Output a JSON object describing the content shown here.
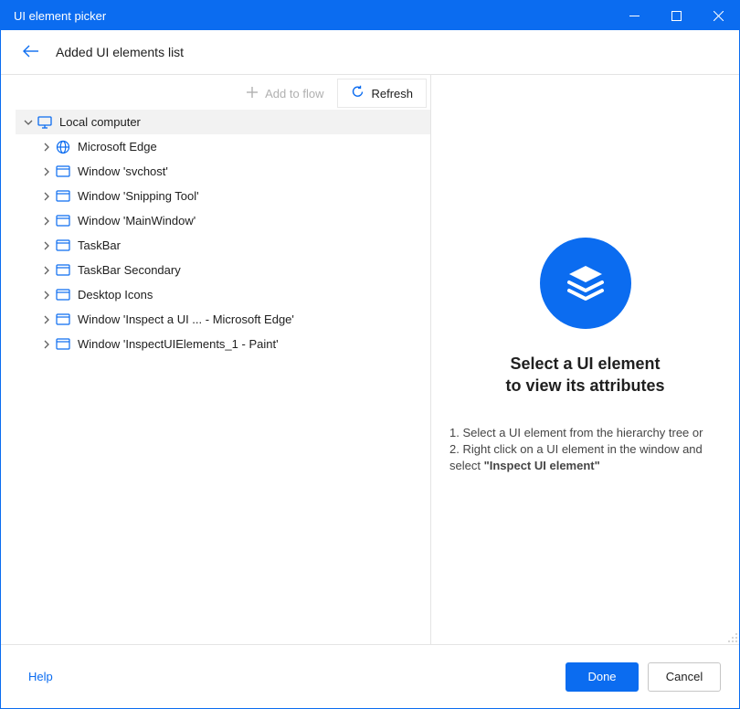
{
  "window": {
    "title": "UI element picker"
  },
  "subheader": {
    "title": "Added UI elements list"
  },
  "toolbar": {
    "add_label": "Add to flow",
    "refresh_label": "Refresh"
  },
  "tree": {
    "root": {
      "label": "Local computer"
    },
    "children": [
      {
        "icon": "globe",
        "label": "Microsoft Edge"
      },
      {
        "icon": "window",
        "label": "Window 'svchost'"
      },
      {
        "icon": "window",
        "label": "Window 'Snipping Tool'"
      },
      {
        "icon": "window",
        "label": "Window 'MainWindow'"
      },
      {
        "icon": "window",
        "label": "TaskBar"
      },
      {
        "icon": "window",
        "label": "TaskBar Secondary"
      },
      {
        "icon": "window",
        "label": "Desktop Icons"
      },
      {
        "icon": "window",
        "label": "Window 'Inspect a UI  ...  - Microsoft Edge'"
      },
      {
        "icon": "window",
        "label": "Window 'InspectUIElements_1 - Paint'"
      }
    ]
  },
  "right": {
    "title_line1": "Select a UI element",
    "title_line2": "to view its attributes",
    "step1": "1. Select a UI element from the hierarchy tree or",
    "step2_pre": "2. Right click on a UI element in the window and select ",
    "step2_bold": "\"Inspect UI element\""
  },
  "footer": {
    "help": "Help",
    "done": "Done",
    "cancel": "Cancel"
  }
}
